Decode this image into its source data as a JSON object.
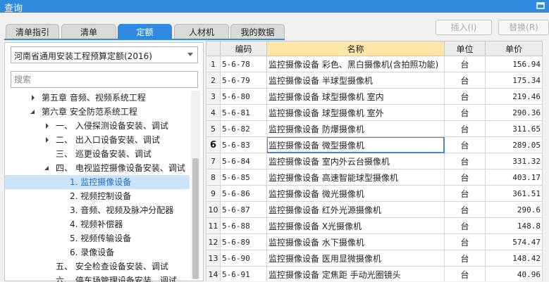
{
  "window": {
    "title": "查询"
  },
  "tabs": [
    {
      "label": "清单指引"
    },
    {
      "label": "清单"
    },
    {
      "label": "定额"
    },
    {
      "label": "人材机"
    },
    {
      "label": "我的数据"
    }
  ],
  "buttons": {
    "insert": "插入(I)",
    "replace": "替换(R)"
  },
  "left": {
    "quota_library": "河南省通用安装工程预算定额(2016)",
    "search_placeholder": "搜索",
    "tree": [
      {
        "label": "第五章 音频、视频系统工程"
      },
      {
        "label": "第六章 安全防范系统工程"
      },
      {
        "label": "一、  入侵探测设备安装、调试"
      },
      {
        "label": "二、  出入口设备安装、调试"
      },
      {
        "label": "三、  巡更设备安装、调试"
      },
      {
        "label": "四、  电视监控摄像设备安装、调试"
      },
      {
        "label": "1. 监控摄像设备"
      },
      {
        "label": "2. 视频控制设备"
      },
      {
        "label": "3. 音频、视频及脉冲分配器"
      },
      {
        "label": "4. 视频补偿器"
      },
      {
        "label": "5. 视频传输设备"
      },
      {
        "label": "6. 录像设备"
      },
      {
        "label": "五、  安全检查设备安装、调试"
      },
      {
        "label": "六、  停车场管理设备安装、调试"
      }
    ]
  },
  "table": {
    "headers": {
      "code": "编码",
      "name": "名称",
      "unit": "单位",
      "price": "单价"
    },
    "rows": [
      {
        "no": "1",
        "code": "5-6-78",
        "name": "监控摄像设备 彩色、黑白摄像机(含拍照功能)",
        "unit": "台",
        "price": "156.94"
      },
      {
        "no": "2",
        "code": "5-6-79",
        "name": "监控摄像设备 半球型摄像机",
        "unit": "台",
        "price": "175.34"
      },
      {
        "no": "3",
        "code": "5-6-80",
        "name": "监控摄像设备 球型摄像机 室内",
        "unit": "台",
        "price": "219.46"
      },
      {
        "no": "4",
        "code": "5-6-81",
        "name": "监控摄像设备 球型摄像机 室外",
        "unit": "台",
        "price": "290.36"
      },
      {
        "no": "5",
        "code": "5-6-82",
        "name": "监控摄像设备 防爆摄像机",
        "unit": "台",
        "price": "311.65"
      },
      {
        "no": "6",
        "code": "5-6-83",
        "name": "监控摄像设备 微型摄像机",
        "unit": "台",
        "price": "289.05"
      },
      {
        "no": "7",
        "code": "5-6-84",
        "name": "监控摄像设备 室内外云台摄像机",
        "unit": "台",
        "price": "331.32"
      },
      {
        "no": "8",
        "code": "5-6-85",
        "name": "监控摄像设备 高速智能球型摄像机",
        "unit": "台",
        "price": "403.17"
      },
      {
        "no": "9",
        "code": "5-6-86",
        "name": "监控摄像设备 微光摄像机",
        "unit": "台",
        "price": "361.51"
      },
      {
        "no": "10",
        "code": "5-6-87",
        "name": "监控摄像设备 红外光源摄像机",
        "unit": "台",
        "price": "290.6"
      },
      {
        "no": "11",
        "code": "5-6-88",
        "name": "监控摄像设备 X光摄像机",
        "unit": "台",
        "price": "148.8"
      },
      {
        "no": "12",
        "code": "5-6-89",
        "name": "监控摄像设备 水下摄像机",
        "unit": "台",
        "price": "574.47"
      },
      {
        "no": "13",
        "code": "5-6-90",
        "name": "监控摄像设备 医用显微摄像机",
        "unit": "台",
        "price": "148.42"
      },
      {
        "no": "14",
        "code": "5-6-91",
        "name": "监控摄像设备 定焦距 手动光圈镜头",
        "unit": "台",
        "price": "40.96"
      }
    ]
  }
}
